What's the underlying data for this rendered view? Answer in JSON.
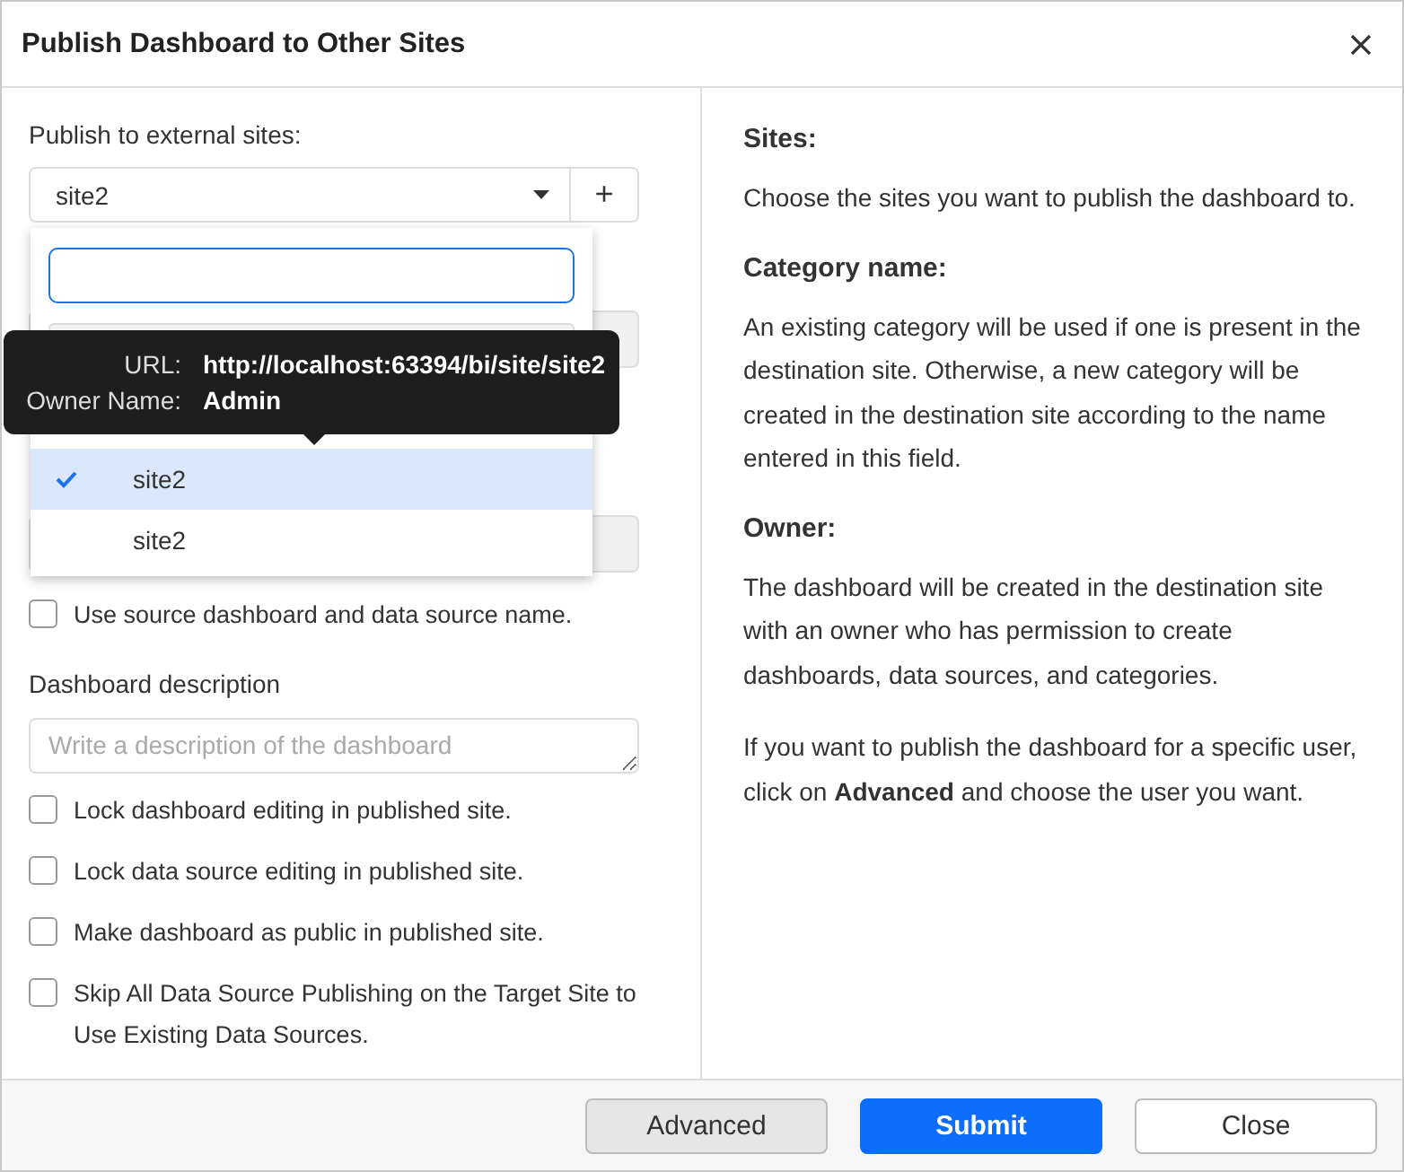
{
  "dialog": {
    "title": "Publish Dashboard to Other Sites"
  },
  "form": {
    "sites_label": "Publish to external sites:",
    "site_select": {
      "value": "site2"
    },
    "add_button": "+",
    "dropdown": {
      "options": [
        {
          "label": "site2",
          "selected": true
        },
        {
          "label": "site2",
          "selected": false
        }
      ]
    },
    "tooltip": {
      "url_label": "URL:",
      "url": "http://localhost:63394/bi/site/site2",
      "owner_label": "Owner Name:",
      "owner": "Admin"
    },
    "use_source_name": {
      "label": "Use source dashboard and data source name.",
      "checked": false
    },
    "description": {
      "label": "Dashboard description",
      "placeholder": "Write a description of the dashboard"
    },
    "options": [
      {
        "label": "Lock dashboard editing in published site.",
        "checked": false
      },
      {
        "label": "Lock data source editing in published site.",
        "checked": false
      },
      {
        "label": "Make dashboard as public in published site.",
        "checked": false
      },
      {
        "label": "Skip All Data Source Publishing on the Target Site to Use Existing Data Sources.",
        "checked": false
      }
    ]
  },
  "help": [
    {
      "kind": "heading",
      "text": "Sites:"
    },
    {
      "kind": "para",
      "text": "Choose the sites you want to publish the dashboard to."
    },
    {
      "kind": "heading",
      "text": "Category name:"
    },
    {
      "kind": "para",
      "text": "An existing category will be used if one is present in the destination site. Otherwise, a new category will be created in the destination site according to the name entered in this field."
    },
    {
      "kind": "heading",
      "text": "Owner:"
    },
    {
      "kind": "para",
      "text": "The dashboard will be created in the destination site with an owner who has permission to create dashboards, data sources, and categories."
    },
    {
      "kind": "para",
      "text": "If you want to publish the dashboard for a specific user, click on **Advanced** and choose the user you want."
    }
  ],
  "footer": {
    "buttons": [
      {
        "label": "Advanced",
        "kind": "secondary"
      },
      {
        "label": "Submit",
        "kind": "primary"
      },
      {
        "label": "Close",
        "kind": "plain"
      }
    ]
  }
}
